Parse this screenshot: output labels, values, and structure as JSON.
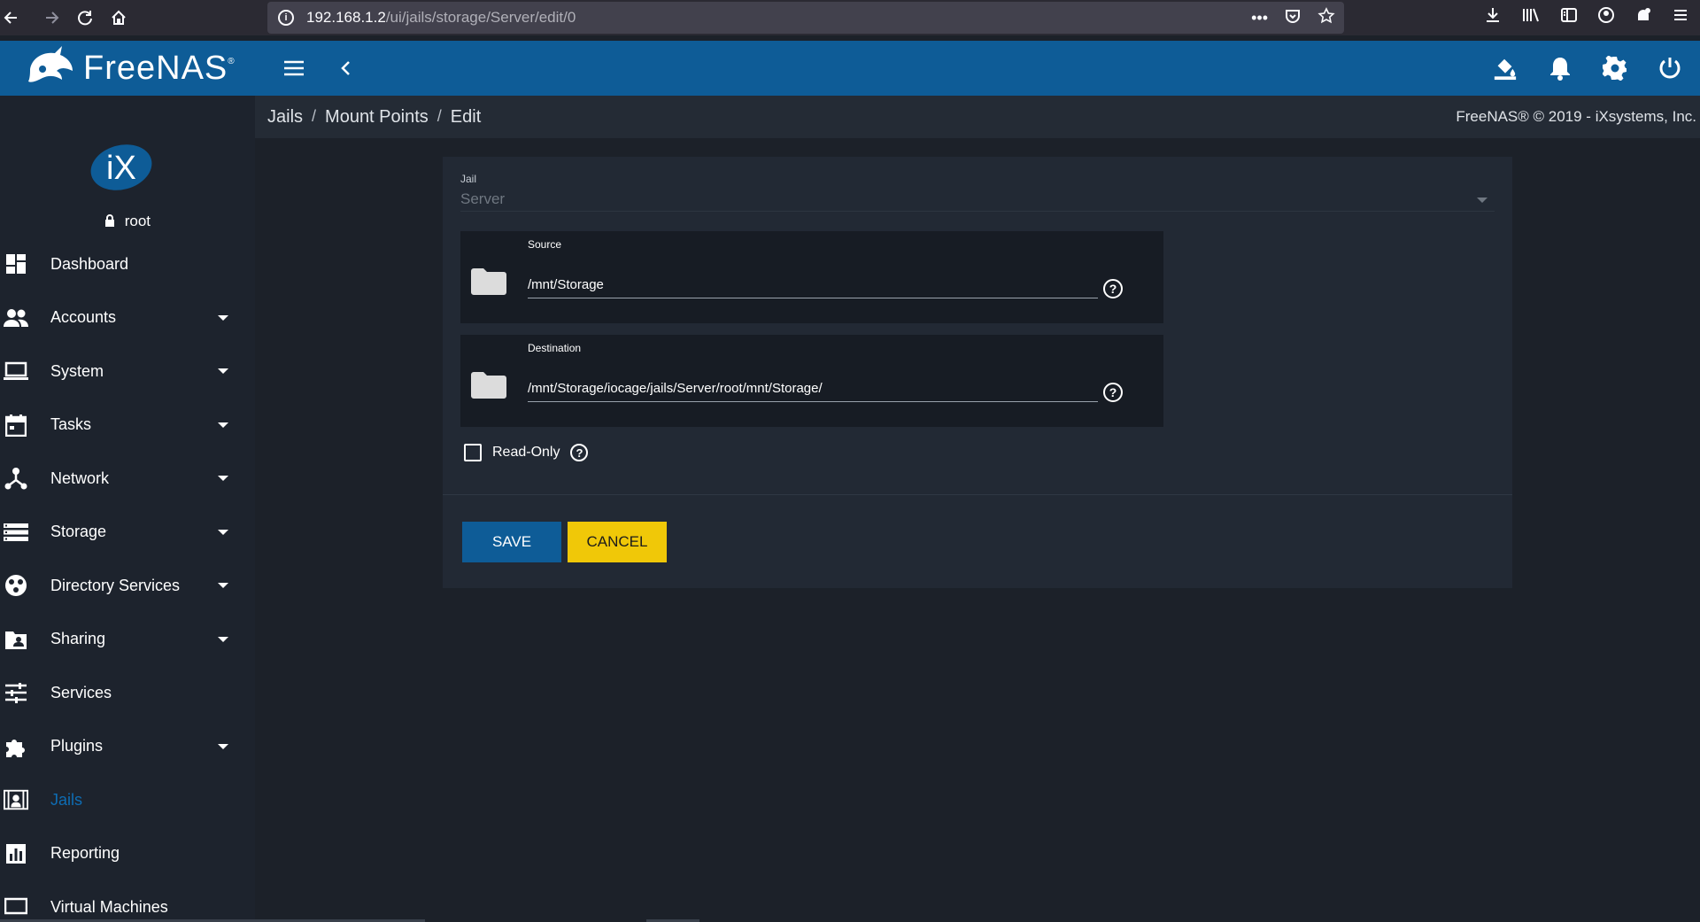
{
  "browser": {
    "url_host": "192.168.1.2",
    "url_path": "/ui/jails/storage/Server/edit/0",
    "more_label": "•••"
  },
  "app": {
    "name": "FreeNAS",
    "trademark": "®",
    "brand_color": "#0e5c97"
  },
  "user": {
    "name": "root"
  },
  "sidebar": {
    "items": [
      {
        "label": "Dashboard",
        "icon": "dashboard-icon",
        "has_caret": false,
        "active": false
      },
      {
        "label": "Accounts",
        "icon": "people-icon",
        "has_caret": true,
        "active": false
      },
      {
        "label": "System",
        "icon": "laptop-icon",
        "has_caret": true,
        "active": false
      },
      {
        "label": "Tasks",
        "icon": "calendar-icon",
        "has_caret": true,
        "active": false
      },
      {
        "label": "Network",
        "icon": "network-icon",
        "has_caret": true,
        "active": false
      },
      {
        "label": "Storage",
        "icon": "storage-icon",
        "has_caret": true,
        "active": false
      },
      {
        "label": "Directory Services",
        "icon": "directory-icon",
        "has_caret": true,
        "active": false
      },
      {
        "label": "Sharing",
        "icon": "sharing-icon",
        "has_caret": true,
        "active": false
      },
      {
        "label": "Services",
        "icon": "tune-icon",
        "has_caret": false,
        "active": false
      },
      {
        "label": "Plugins",
        "icon": "puzzle-icon",
        "has_caret": true,
        "active": false
      },
      {
        "label": "Jails",
        "icon": "jail-icon",
        "has_caret": false,
        "active": true
      },
      {
        "label": "Reporting",
        "icon": "chart-icon",
        "has_caret": false,
        "active": false
      },
      {
        "label": "Virtual Machines",
        "icon": "vm-icon",
        "has_caret": false,
        "active": false
      }
    ]
  },
  "breadcrumb": {
    "items": [
      "Jails",
      "Mount Points",
      "Edit"
    ],
    "separator": "/"
  },
  "copyright": "FreeNAS® © 2019 - iXsystems, Inc.",
  "form": {
    "jail": {
      "label": "Jail",
      "value": "Server"
    },
    "source": {
      "label": "Source",
      "value": "/mnt/Storage"
    },
    "destination": {
      "label": "Destination",
      "value": "/mnt/Storage/iocage/jails/Server/root/mnt/Storage/"
    },
    "read_only": {
      "label": "Read-Only",
      "checked": false
    },
    "help_glyph": "?",
    "save_label": "SAVE",
    "cancel_label": "CANCEL",
    "cancel_color": "#f0c808"
  }
}
